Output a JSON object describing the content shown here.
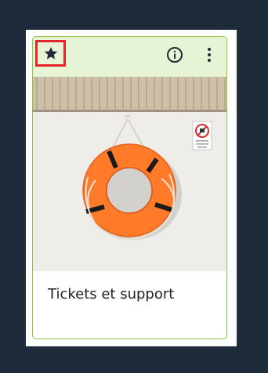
{
  "card": {
    "title": "Tickets et support",
    "favorite": true,
    "actions": {
      "favorite_icon": "star-icon",
      "info_icon": "info-icon",
      "more_icon": "more-vertical-icon"
    },
    "image": {
      "sign_text": "Ne pas jeter de bouée"
    }
  },
  "colors": {
    "background": "#1e2b3a",
    "card_border": "#8cc63f",
    "header_bg": "#e6f3d5",
    "highlight": "#e3262b",
    "lifebuoy": "#ff7a29"
  }
}
